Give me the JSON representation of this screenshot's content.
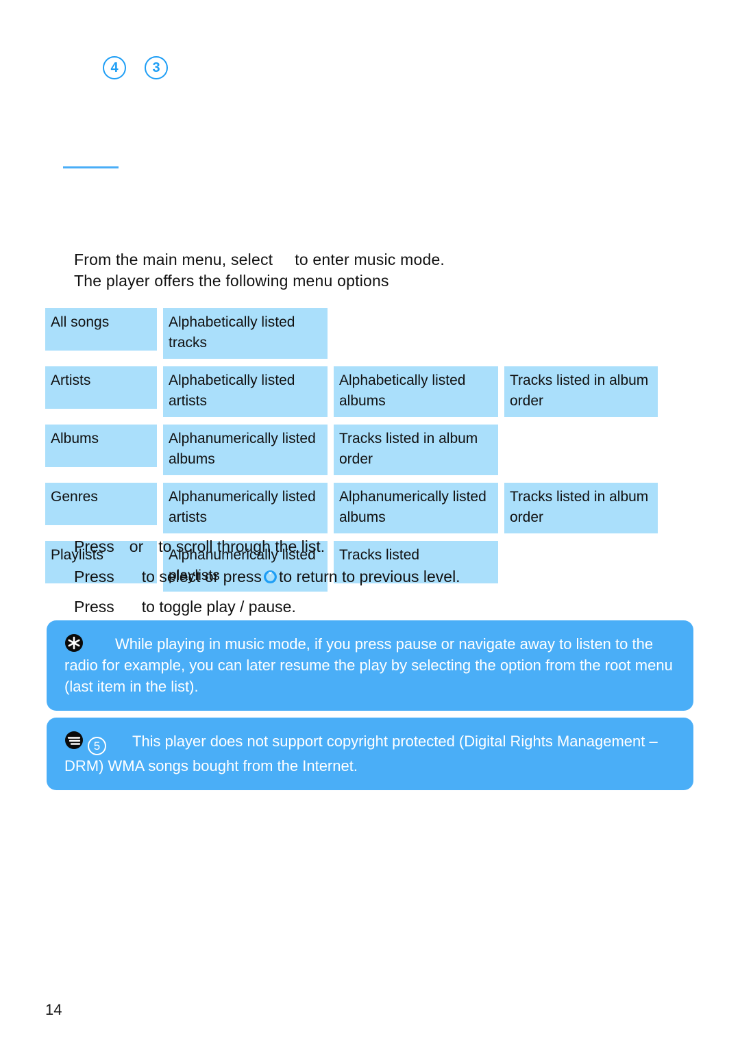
{
  "step_markers": [
    {
      "label": "4"
    },
    {
      "label": "3"
    }
  ],
  "intro": {
    "line1_before": "From the main menu, select",
    "line1_after": "to enter music mode.",
    "line2": "The player offers the following menu options"
  },
  "menu_table": {
    "rows": [
      {
        "name": "All songs",
        "level2": "Alphabetically listed tracks",
        "level3": "",
        "level4": ""
      },
      {
        "name": "Artists",
        "level2": "Alphabetically listed artists",
        "level3": "Alphabetically listed albums",
        "level4": "Tracks listed in album order"
      },
      {
        "name": "Albums",
        "level2": "Alphanumerically listed albums",
        "level3": "Tracks listed in album order",
        "level4": ""
      },
      {
        "name": "Genres",
        "level2": "Alphanumerically listed artists",
        "level3": "Alphanumerically listed albums",
        "level4": "Tracks listed in album order"
      },
      {
        "name": "Playlists",
        "level2": "Alphanumerically listed playlists",
        "level3": "Tracks listed",
        "level4": ""
      }
    ]
  },
  "press_instructions": {
    "line1_a": "Press",
    "line1_b": "or",
    "line1_c": "to scroll through the list.",
    "line2_a": "Press",
    "line2_b": "to select or press",
    "line2_c": "to return to previous level.",
    "line3_a": "Press",
    "line3_b": "to toggle play / pause."
  },
  "callouts": [
    {
      "icon": "asterisk-icon",
      "text": "While playing in music mode, if you press pause or navigate away to listen to the radio for example, you can later resume the play by selecting the option from the root menu (last item in the list)."
    },
    {
      "icon": "note-icon",
      "badge": "5",
      "text": "This player does not support copyright protected (Digital Rights Management – DRM) WMA songs bought from the Internet."
    }
  ],
  "page_number": "14",
  "colors": {
    "accent_blue": "#4aaef7",
    "table_cell_blue": "#aadffb",
    "marker_blue": "#1e9ef5"
  }
}
